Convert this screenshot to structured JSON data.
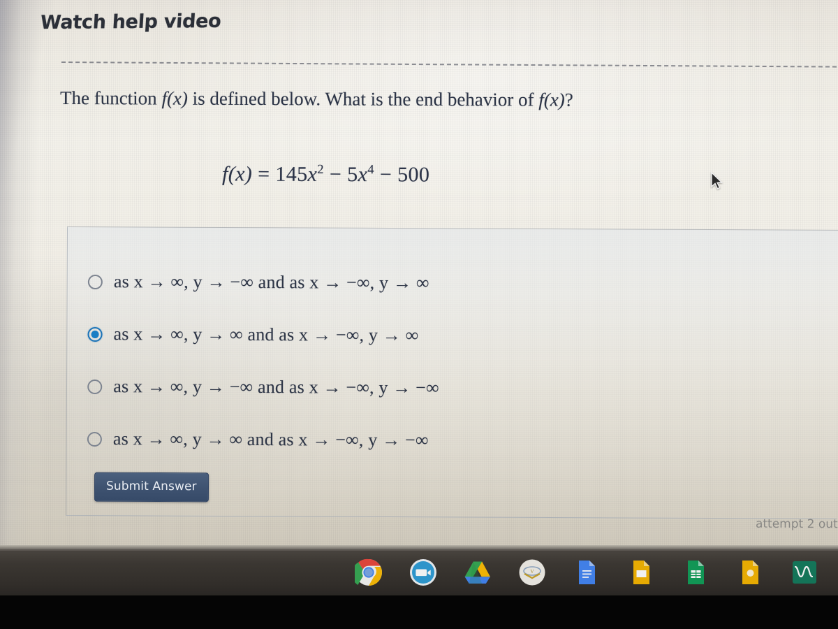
{
  "page": {
    "help_link": "Watch help video",
    "question_prefix": "The function ",
    "question_fx_1": "f(x)",
    "question_middle": " is defined below. What is the end behavior of ",
    "question_fx_2": "f(x)",
    "question_suffix": "?",
    "equation": "f(x) = 145x² − 5x⁴ − 500",
    "equation_parts": {
      "lhs": "f(x)",
      "equals": "=",
      "term1_coeff": "145",
      "term1_var": "x",
      "term1_exp": "2",
      "op1": "−",
      "term2_coeff": "5",
      "term2_var": "x",
      "term2_exp": "4",
      "op2": "−",
      "term3": "500"
    },
    "submit_label": "Submit Answer",
    "attempt_note": "attempt 2 out",
    "accent_color": "#1a7ec4",
    "button_color": "#3e5270",
    "text_color": "#2d3546"
  },
  "options": [
    {
      "id": "option-1",
      "label": "as x → ∞, y → −∞ and as x → −∞, y → ∞",
      "selected": false
    },
    {
      "id": "option-2",
      "label": "as x → ∞, y → ∞ and as x → −∞, y → ∞",
      "selected": true
    },
    {
      "id": "option-3",
      "label": "as x → ∞, y → −∞ and as x → −∞, y → −∞",
      "selected": false
    },
    {
      "id": "option-4",
      "label": "as x → ∞, y → ∞ and as x → −∞, y → −∞",
      "selected": false
    }
  ],
  "taskbar": {
    "apps": [
      {
        "name": "chrome-icon",
        "label": "Chrome"
      },
      {
        "name": "zoom-icon",
        "label": "Zoom"
      },
      {
        "name": "google-drive-icon",
        "label": "Drive"
      },
      {
        "name": "school-logo-icon",
        "label": "School"
      },
      {
        "name": "google-docs-icon",
        "label": "Docs"
      },
      {
        "name": "google-slides-icon",
        "label": "Slides"
      },
      {
        "name": "google-sheets-icon",
        "label": "Sheets"
      },
      {
        "name": "google-keep-icon",
        "label": "Keep"
      },
      {
        "name": "desmos-icon",
        "label": "Desmos"
      }
    ]
  }
}
